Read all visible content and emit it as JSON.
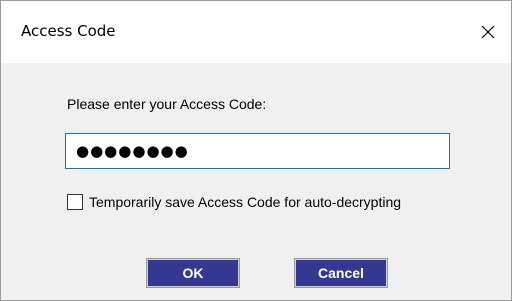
{
  "window": {
    "title": "Access Code",
    "close_icon": "close-icon"
  },
  "form": {
    "prompt": "Please enter your Access Code:",
    "code_value": "●●●●●●●●",
    "save_checked": false,
    "save_label": "Temporarily save Access Code for auto-decrypting"
  },
  "buttons": {
    "ok_label": "OK",
    "cancel_label": "Cancel"
  },
  "colors": {
    "button_bg": "#353890",
    "input_focus_border": "#0078d7",
    "dialog_bg": "#f0f0f0"
  }
}
